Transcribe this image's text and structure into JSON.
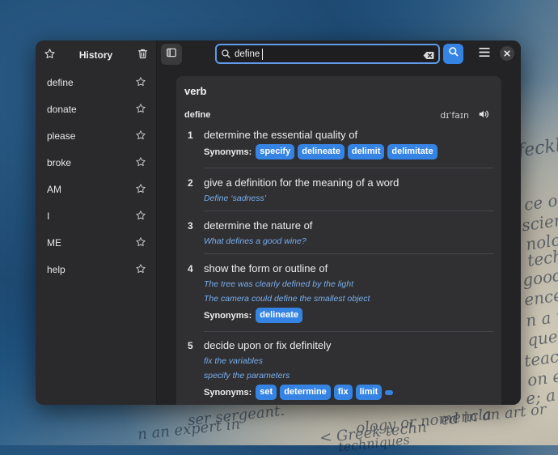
{
  "sidebar": {
    "title": "History",
    "items": [
      {
        "label": "define"
      },
      {
        "label": "donate"
      },
      {
        "label": "please"
      },
      {
        "label": "broke"
      },
      {
        "label": "AM"
      },
      {
        "label": "I"
      },
      {
        "label": "ME"
      },
      {
        "label": "help"
      }
    ]
  },
  "search": {
    "value": "define"
  },
  "entry": {
    "part_of_speech": "verb",
    "word": "define",
    "pronunciation": "dɪˈfaɪn",
    "synonyms_label": "Synonyms:",
    "senses": [
      {
        "num": "1",
        "definition": "determine the essential quality of",
        "examples": [],
        "synonyms": [
          "specify",
          "delineate",
          "delimit",
          "delimitate"
        ]
      },
      {
        "num": "2",
        "definition": "give a definition for the meaning of a word",
        "examples": [
          "Define ‘sadness’"
        ],
        "synonyms": []
      },
      {
        "num": "3",
        "definition": "determine the nature of",
        "examples": [
          "What defines a good wine?"
        ],
        "synonyms": []
      },
      {
        "num": "4",
        "definition": "show the form or outline of",
        "examples": [
          "The tree was clearly defined by the light",
          "The camera could define the smallest object"
        ],
        "synonyms": [
          "delineate"
        ]
      },
      {
        "num": "5",
        "definition": "decide upon or fix definitely",
        "examples": [
          "fix the variables",
          "specify the parameters"
        ],
        "synonyms": [
          "set",
          "determine",
          "fix",
          "limit"
        ]
      }
    ]
  },
  "background_text": [
    "feckle",
    "ce o",
    "scienc",
    "nolog",
    "techn",
    "goods",
    "ence o",
    "n a pa",
    "ques",
    "teach",
    "on e",
    "e; a",
    "ser sergeant.",
    "n an expert in",
    "ology or nomencla",
    "ed in an art or",
    "< Greek techn",
    "techniques"
  ],
  "colors": {
    "accent": "#3584e4",
    "example_text": "#78aeed",
    "window_bg": "#2d2d2f"
  }
}
